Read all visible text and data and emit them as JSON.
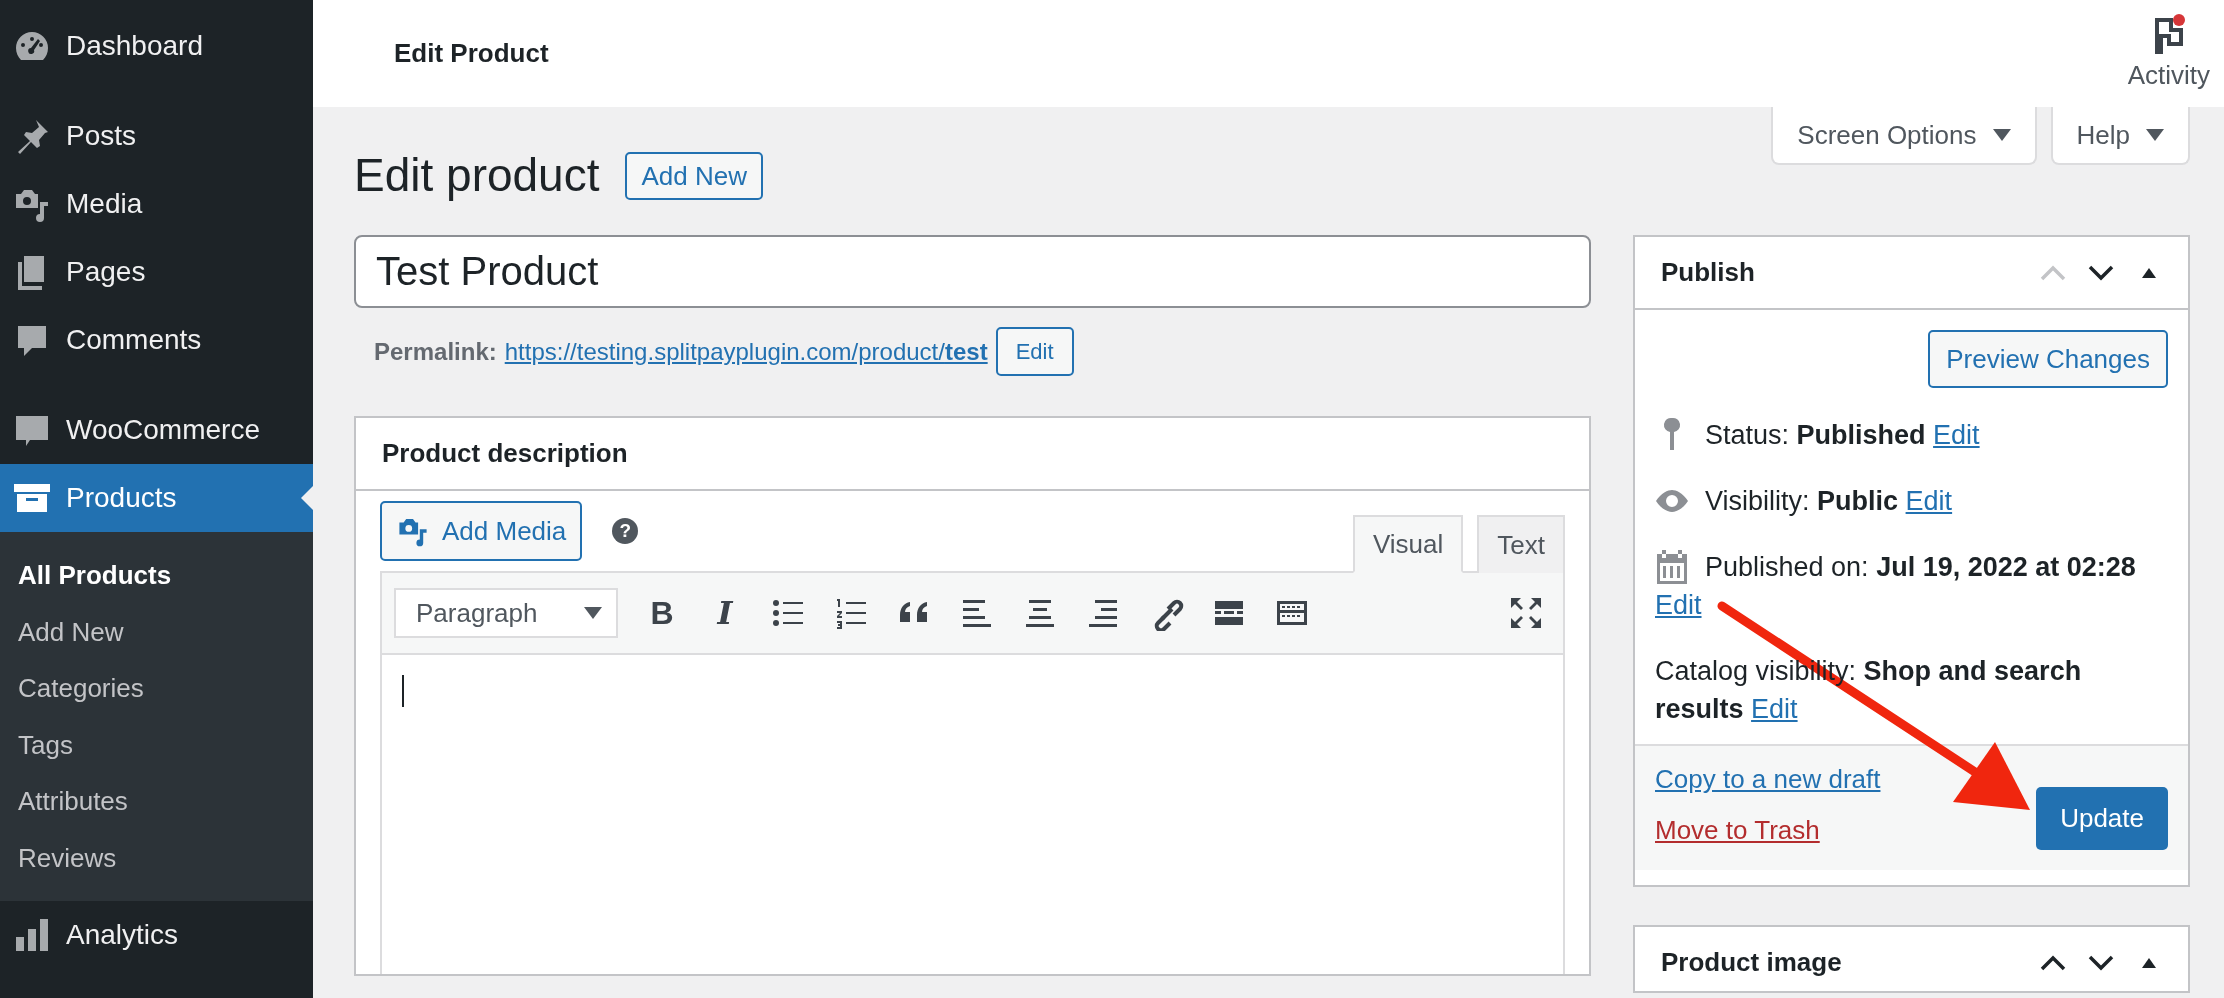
{
  "sidebar": {
    "items": [
      {
        "label": "Dashboard",
        "selected": false
      },
      {
        "label": "Posts",
        "selected": false
      },
      {
        "label": "Media",
        "selected": false
      },
      {
        "label": "Pages",
        "selected": false
      },
      {
        "label": "Comments",
        "selected": false
      },
      {
        "label": "WooCommerce",
        "selected": false
      },
      {
        "label": "Products",
        "selected": true,
        "children": [
          {
            "label": "All Products",
            "selected": true
          },
          {
            "label": "Add New",
            "selected": false
          },
          {
            "label": "Categories",
            "selected": false
          },
          {
            "label": "Tags",
            "selected": false
          },
          {
            "label": "Attributes",
            "selected": false
          },
          {
            "label": "Reviews",
            "selected": false
          }
        ]
      },
      {
        "label": "Analytics",
        "selected": false
      }
    ]
  },
  "header": {
    "title": "Edit Product",
    "activity": "Activity"
  },
  "screen_tabs": [
    {
      "label": "Screen Options"
    },
    {
      "label": "Help"
    }
  ],
  "page": {
    "heading": "Edit product",
    "add_new": "Add New"
  },
  "title_field": {
    "value": "Test Product"
  },
  "permalink": {
    "label": "Permalink:",
    "url": "https://testing.splitpayplugin.com/product/**test**",
    "edit": "Edit"
  },
  "description": {
    "title": "Product description",
    "add_media": "Add Media",
    "help": "?",
    "tabs": [
      {
        "label": "Visual",
        "selected": true
      },
      {
        "label": "Text",
        "selected": false
      }
    ],
    "format": "Paragraph",
    "toolbar": [
      {
        "kind": "bold",
        "glyph": "B"
      },
      {
        "kind": "italic",
        "glyph": "I"
      },
      {
        "kind": "bullets"
      },
      {
        "kind": "numbers"
      },
      {
        "kind": "quote"
      },
      {
        "kind": "left"
      },
      {
        "kind": "center"
      },
      {
        "kind": "right"
      },
      {
        "kind": "link"
      },
      {
        "kind": "more"
      },
      {
        "kind": "kitchen"
      },
      {
        "kind": "fullscreen"
      }
    ]
  },
  "publish": {
    "title": "Publish",
    "move_up_disabled": true,
    "preview": "Preview Changes",
    "rows": [
      {
        "kind": "status",
        "text": "Status: **Published**",
        "edit": "Edit"
      },
      {
        "kind": "visibility",
        "text": "Visibility: **Public**",
        "edit": "Edit"
      },
      {
        "kind": "date",
        "text": "Published on: **Jul 19, 2022 at 02:28**",
        "edit": "Edit"
      },
      {
        "kind": "catalog",
        "text": "Catalog visibility: **Shop and search results**",
        "edit": "Edit"
      }
    ],
    "copy": "Copy to a new draft",
    "trash": "Move to Trash",
    "update": "Update"
  },
  "product_image": {
    "title": "Product image",
    "move_up_disabled": false
  }
}
